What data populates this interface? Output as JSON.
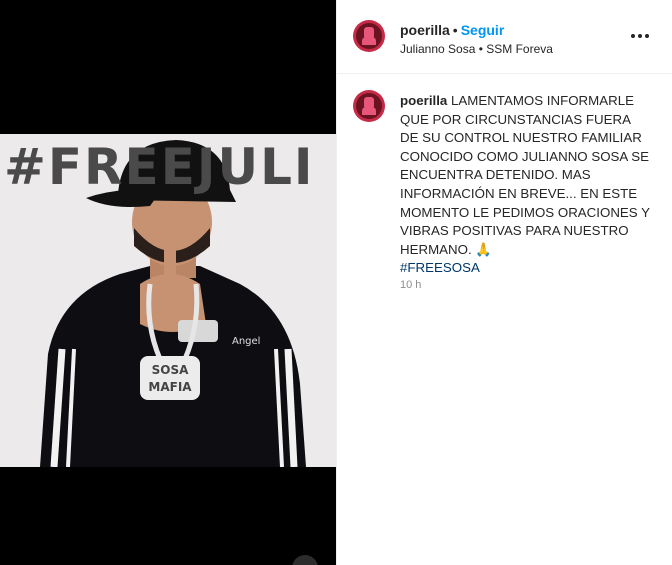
{
  "post": {
    "image_hashtag": "#FREEJULI",
    "shirt_text": "Angel",
    "chain_text": "SOSA MAFIA"
  },
  "header": {
    "username": "poerilla",
    "separator": "•",
    "follow_label": "Seguir",
    "subline": "Julianno Sosa • SSM Foreva",
    "more_icon": "more-options-icon"
  },
  "caption": {
    "username": "poerilla",
    "text": "LAMENTAMOS INFORMARLE QUE POR CIRCUNSTANCIAS FUERA DE SU CONTROL NUESTRO FAMILIAR CONOCIDO COMO JULIANNO SOSA SE ENCUENTRA DETENIDO. MAS INFORMACIÓN EN BREVE... EN ESTE MOMENTO LE PEDIMOS ORACIONES Y VIBRAS POSITIVAS PARA NUESTRO HERMANO. 🙏",
    "hashtag": "#FREESOSA",
    "timestamp": "10 h"
  }
}
